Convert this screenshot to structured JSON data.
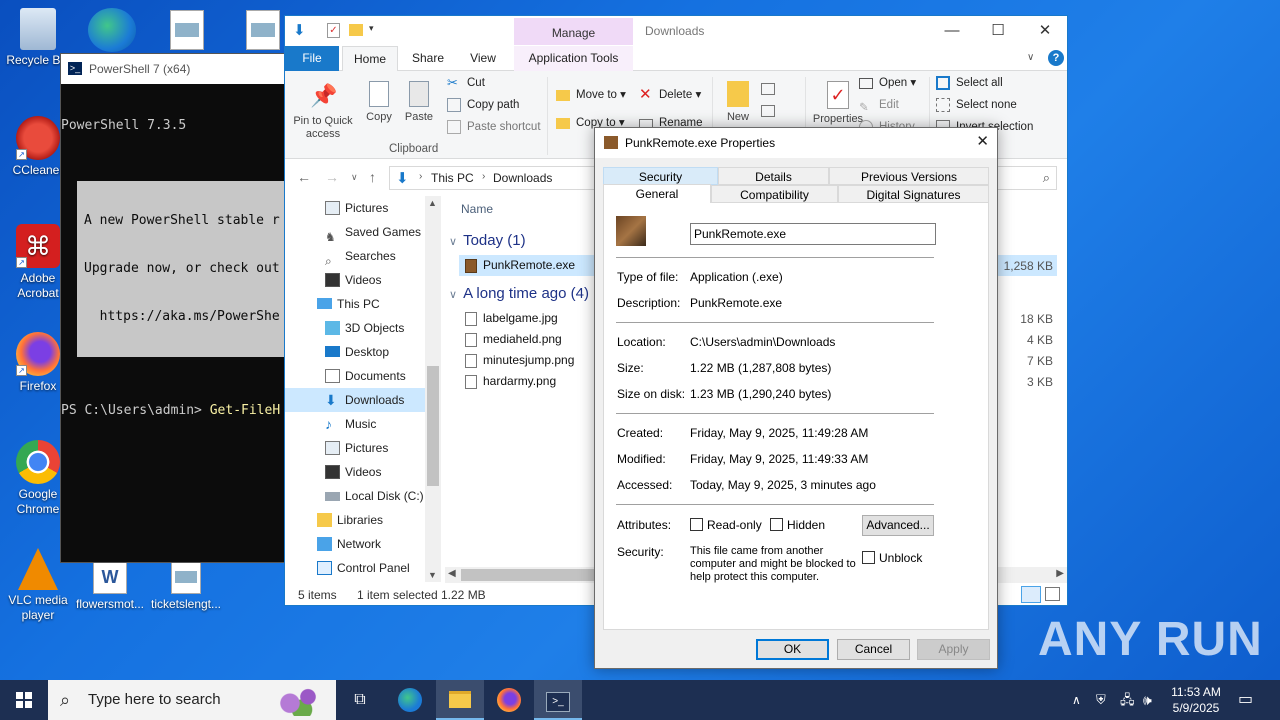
{
  "desktop": {
    "icons": [
      {
        "label": "Recycle Bin"
      },
      {
        "label": "CCleaner"
      },
      {
        "label": "Adobe Acrobat"
      },
      {
        "label": "Firefox"
      },
      {
        "label": "Google Chrome"
      },
      {
        "label": "VLC media player"
      },
      {
        "label": "flowersmot..."
      },
      {
        "label": "ticketslengt..."
      }
    ]
  },
  "powershell": {
    "title": "PowerShell 7 (x64)",
    "version_line": "PowerShell 7.3.5",
    "notice_lines": [
      "A new PowerShell stable r",
      "Upgrade now, or check out",
      "  https://aka.ms/PowerShe"
    ],
    "prompt": "PS C:\\Users\\admin> ",
    "command": "Get-FileH"
  },
  "explorer": {
    "context_tab": "Manage",
    "window_title": "Downloads",
    "tabs": [
      "File",
      "Home",
      "Share",
      "View",
      "Application Tools"
    ],
    "ribbon": {
      "pin": "Pin to Quick access",
      "copy": "Copy",
      "paste": "Paste",
      "cut": "Cut",
      "copy_path": "Copy path",
      "paste_shortcut": "Paste shortcut",
      "clipboard_group": "Clipboard",
      "move_to": "Move to",
      "delete": "Delete",
      "copy_to": "Copy to",
      "rename": "Rename",
      "new": "New",
      "properties": "Properties",
      "open": "Open",
      "edit": "Edit",
      "history": "History",
      "select_all": "Select all",
      "select_none": "Select none",
      "invert_selection": "Invert selection"
    },
    "breadcrumb": [
      "This PC",
      "Downloads"
    ],
    "nav_items": [
      {
        "label": "Pictures"
      },
      {
        "label": "Saved Games"
      },
      {
        "label": "Searches"
      },
      {
        "label": "Videos"
      },
      {
        "label": "This PC"
      },
      {
        "label": "3D Objects"
      },
      {
        "label": "Desktop"
      },
      {
        "label": "Documents"
      },
      {
        "label": "Downloads"
      },
      {
        "label": "Music"
      },
      {
        "label": "Pictures"
      },
      {
        "label": "Videos"
      },
      {
        "label": "Local Disk (C:)"
      },
      {
        "label": "Libraries"
      },
      {
        "label": "Network"
      },
      {
        "label": "Control Panel"
      }
    ],
    "column_name": "Name",
    "group_today": "Today (1)",
    "group_long_ago": "A long time ago (4)",
    "files_today": [
      {
        "name": "PunkRemote.exe",
        "size": "1,258 KB"
      }
    ],
    "files_old": [
      {
        "name": "labelgame.jpg",
        "size": "18 KB"
      },
      {
        "name": "mediaheld.png",
        "size": "4 KB"
      },
      {
        "name": "minutesjump.png",
        "size": "7 KB"
      },
      {
        "name": "hardarmy.png",
        "size": "3 KB"
      }
    ],
    "status": {
      "items": "5 items",
      "selected": "1 item selected",
      "size": "1.22 MB"
    }
  },
  "dialog": {
    "title": "PunkRemote.exe Properties",
    "tabs_row1": [
      "Security",
      "Details",
      "Previous Versions"
    ],
    "tabs_row2": [
      "General",
      "Compatibility",
      "Digital Signatures"
    ],
    "filename": "PunkRemote.exe",
    "type_label": "Type of file:",
    "type_value": "Application (.exe)",
    "desc_label": "Description:",
    "desc_value": "PunkRemote.exe",
    "location_label": "Location:",
    "location_value": "C:\\Users\\admin\\Downloads",
    "size_label": "Size:",
    "size_value": "1.22 MB (1,287,808 bytes)",
    "size_disk_label": "Size on disk:",
    "size_disk_value": "1.23 MB (1,290,240 bytes)",
    "created_label": "Created:",
    "created_value": "Friday, May 9, 2025, 11:49:28 AM",
    "modified_label": "Modified:",
    "modified_value": "Friday, May 9, 2025, 11:49:33 AM",
    "accessed_label": "Accessed:",
    "accessed_value": "Today, May 9, 2025, 3 minutes ago",
    "attributes_label": "Attributes:",
    "readonly": "Read-only",
    "hidden": "Hidden",
    "advanced": "Advanced...",
    "security_label": "Security:",
    "security_text": [
      "This file came from another",
      "computer and might be blocked to",
      "help protect this computer."
    ],
    "unblock": "Unblock",
    "ok": "OK",
    "cancel": "Cancel",
    "apply": "Apply"
  },
  "taskbar": {
    "search_placeholder": "Type here to search",
    "time": "11:53 AM",
    "date": "5/9/2025"
  },
  "watermark": "ANY RUN"
}
